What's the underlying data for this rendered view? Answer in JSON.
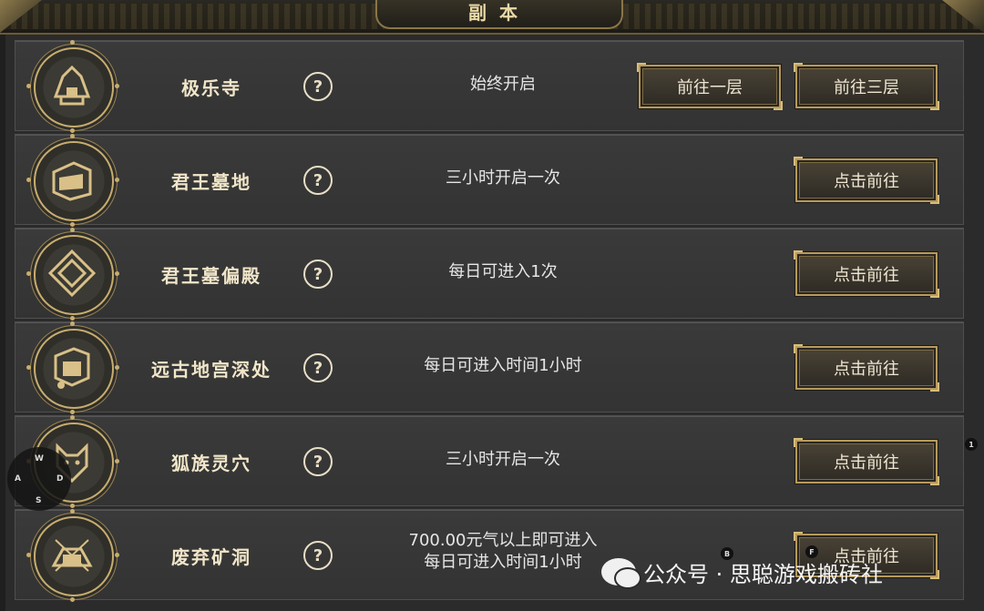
{
  "header": {
    "title": "副本"
  },
  "rows": [
    {
      "name": "极乐寺",
      "help": "?",
      "desc": [
        "始终开启"
      ],
      "buttons": [
        "前往一层",
        "前往三层"
      ]
    },
    {
      "name": "君王墓地",
      "help": "?",
      "desc": [
        "三小时开启一次"
      ],
      "buttons": [
        "点击前往"
      ]
    },
    {
      "name": "君王墓偏殿",
      "help": "?",
      "desc": [
        "每日可进入1次"
      ],
      "buttons": [
        "点击前往"
      ]
    },
    {
      "name": "远古地宫深处",
      "help": "?",
      "desc": [
        "每日可进入时间1小时"
      ],
      "buttons": [
        "点击前往"
      ]
    },
    {
      "name": "狐族灵穴",
      "help": "?",
      "desc": [
        "三小时开启一次"
      ],
      "buttons": [
        "点击前往"
      ]
    },
    {
      "name": "废弃矿洞",
      "help": "?",
      "desc": [
        "700.00元气以上即可进入",
        "每日可进入时间1小时"
      ],
      "buttons": [
        "点击前往"
      ]
    }
  ],
  "overlay": {
    "joystick_keys": {
      "up": "W",
      "left": "A",
      "right": "D",
      "down": "S"
    },
    "hint_keys": [
      "1",
      "B",
      "F"
    ]
  },
  "watermark": {
    "text": "公众号 · 思聪游戏搬砖社"
  },
  "colors": {
    "gold": "#c7ad6f",
    "panel": "#333333",
    "text": "#e6e6e6"
  },
  "icons": [
    "temple-icon",
    "tomb-icon",
    "hall-icon",
    "palace-icon",
    "fox-icon",
    "mine-icon"
  ]
}
